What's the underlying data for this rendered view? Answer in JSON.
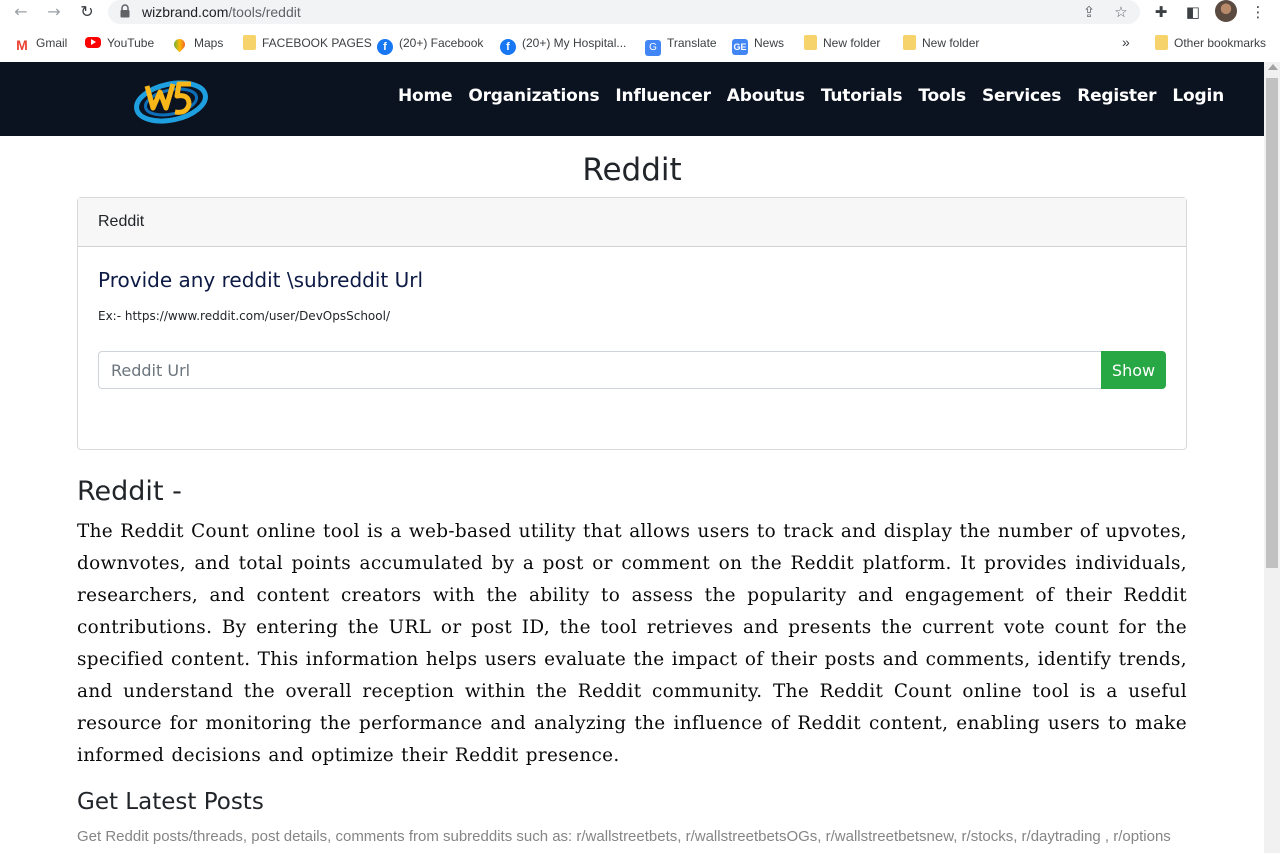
{
  "browser": {
    "url_domain": "wizbrand.com",
    "url_path": "/tools/reddit"
  },
  "bookmarks": [
    {
      "label": "Gmail",
      "icon": "gmail-icon"
    },
    {
      "label": "YouTube",
      "icon": "youtube-icon"
    },
    {
      "label": "Maps",
      "icon": "maps-icon"
    },
    {
      "label": "FACEBOOK PAGES",
      "icon": "folder-icon"
    },
    {
      "label": "(20+) Facebook",
      "icon": "facebook-icon"
    },
    {
      "label": "(20+) My Hospital...",
      "icon": "facebook-icon"
    },
    {
      "label": "Translate",
      "icon": "translate-icon"
    },
    {
      "label": "News",
      "icon": "news-icon"
    },
    {
      "label": "New folder",
      "icon": "folder-icon"
    },
    {
      "label": "New folder",
      "icon": "folder-icon"
    },
    {
      "label": "Other bookmarks",
      "icon": "folder-icon"
    }
  ],
  "site_nav": [
    "Home",
    "Organizations",
    "Influencer",
    "Aboutus",
    "Tutorials",
    "Tools",
    "Services",
    "Register",
    "Login"
  ],
  "page_title": "Reddit",
  "card": {
    "header": "Reddit",
    "heading": "Provide any reddit \\subreddit Url",
    "example": "Ex:- https://www.reddit.com/user/DevOpsSchool/",
    "input_placeholder": "Reddit Url",
    "button_label": "Show"
  },
  "section_heading": "Reddit -",
  "description": "The Reddit Count online tool is a web-based utility that allows users to track and display the number of upvotes, downvotes, and total points accumulated by a post or comment on the Reddit platform. It provides individuals, researchers, and content creators with the ability to assess the popularity and engagement of their Reddit contributions. By entering the URL or post ID, the tool retrieves and presents the current vote count for the specified content. This information helps users evaluate the impact of their posts and comments, identify trends, and understand the overall reception within the Reddit community. The Reddit Count online tool is a useful resource for monitoring the performance and analyzing the influence of Reddit content, enabling users to make informed decisions and optimize their Reddit presence.",
  "posts": {
    "heading": "Get Latest Posts",
    "subtitle": "Get Reddit posts/threads, post details, comments from subreddits such as: r/wallstreetbets, r/wallstreetbetsOGs, r/wallstreetbetsnew, r/stocks, r/daytrading , r/options"
  },
  "colors": {
    "header_bg": "#0c1320",
    "show_button": "#28a745"
  }
}
